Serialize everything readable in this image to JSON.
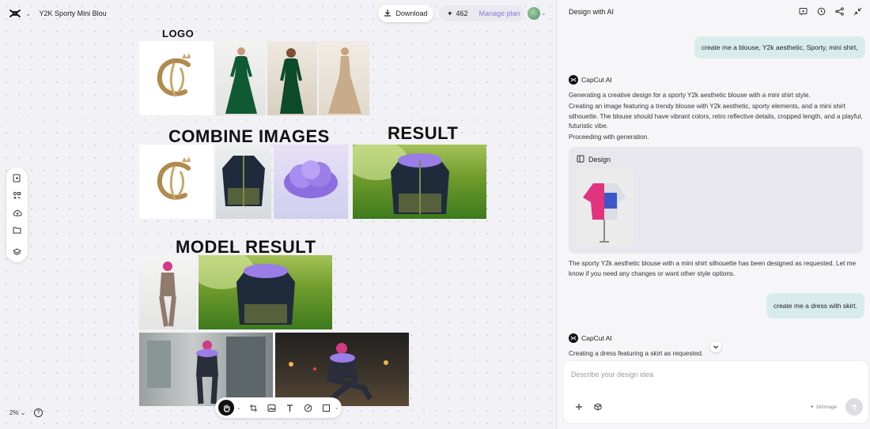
{
  "header": {
    "project_title": "Y2K Sporty Mini Blou",
    "download_label": "Download",
    "credits": "462",
    "manage_plan_label": "Manage plan"
  },
  "canvas": {
    "labels": {
      "logo": "LOGO",
      "combine": "COMBINE IMAGES",
      "result": "RESULT",
      "model_result": "MODEL RESULT"
    },
    "zoom": "2%"
  },
  "panel": {
    "title": "Design with AI",
    "messages": {
      "user_1": "create me a blouse, Y2k aesthetic, Sporty, mini shirt,",
      "ai_name_1": "CapCut AI",
      "ai_1_p1": "Generating a creative design for a sporty Y2k aesthetic blouse with a mini shirt style.",
      "ai_1_p2": "Creating an image featuring a trendy blouse with Y2k aesthetic, sporty elements, and a mini shirt silhouette. The blouse should have vibrant colors, retro reflective details, cropped length, and a playful, futuristic vibe.",
      "ai_1_p3": "Proceeding with generation.",
      "design_card_title": "Design",
      "ai_1_result": "The sporty Y2k aesthetic blouse with a mini shirt silhouette has been designed as requested. Let me know if you need any changes or want other style options.",
      "user_2": "create me a dress with skirt.",
      "ai_name_2": "CapCut AI",
      "ai_2_p1": "Creating a dress featuring a skirt as requested."
    },
    "composer": {
      "placeholder": "Describe your design idea",
      "cost": "16/image"
    }
  },
  "colors": {
    "accent_purple": "#8a7bd6",
    "user_bubble": "#d9ecec",
    "canvas_bg": "#f1f1f6"
  }
}
